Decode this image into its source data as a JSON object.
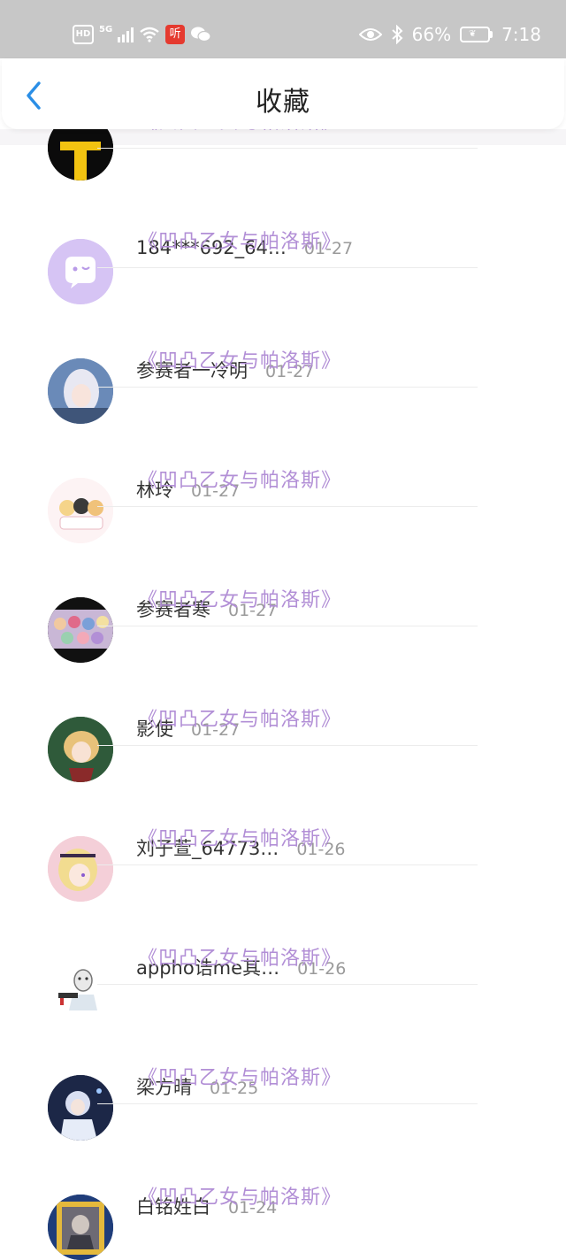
{
  "status_bar": {
    "left_icons": [
      "hd-icon",
      "5g-signal-icon",
      "wifi-icon",
      "listen-app-icon",
      "wechat-icon"
    ],
    "network": "5G",
    "app_badge": "听",
    "battery": "66%",
    "time": "7:18"
  },
  "header": {
    "title": "收藏",
    "back_icon": "chevron-left-icon"
  },
  "favorites": [
    {
      "name": "",
      "date": "",
      "work": "《凹凸乙女与帕洛斯》",
      "avatar": "black-gold-avatar"
    },
    {
      "name": "184***692_64…",
      "date": "01-27",
      "work": "《凹凸乙女与帕洛斯》",
      "avatar": "default-purple-avatar"
    },
    {
      "name": "参赛者一冷明",
      "date": "01-27",
      "work": "《凹凸乙女与帕洛斯》",
      "avatar": "anime-silver-hair-avatar"
    },
    {
      "name": "林玲",
      "date": "01-27",
      "work": "《凹凸乙女与帕洛斯》",
      "avatar": "chibi-group-avatar"
    },
    {
      "name": "参赛者寒",
      "date": "01-27",
      "work": "《凹凸乙女与帕洛斯》",
      "avatar": "chibi-crowd-avatar"
    },
    {
      "name": "影使",
      "date": "01-27",
      "work": "《凹凸乙女与帕洛斯》",
      "avatar": "anime-green-avatar"
    },
    {
      "name": "刘子萱_64773…",
      "date": "01-26",
      "work": "《凹凸乙女与帕洛斯》",
      "avatar": "anime-blonde-avatar"
    },
    {
      "name": "appho诰me其…",
      "date": "01-26",
      "work": "《凹凸乙女与帕洛斯》",
      "avatar": "mask-figure-avatar"
    },
    {
      "name": "梁方晴",
      "date": "01-25",
      "work": "《凹凸乙女与帕洛斯》",
      "avatar": "dark-blue-anime-avatar"
    },
    {
      "name": "白铭姓白",
      "date": "01-24",
      "work": "《凹凸乙女与帕洛斯》",
      "avatar": "framed-portrait-avatar"
    }
  ],
  "colors": {
    "status_bar_bg": "#c7c7c7",
    "accent_blue": "#2a8ee6",
    "work_title_purple": "#b28fd6",
    "default_avatar_purple": "#d6c4f4"
  }
}
